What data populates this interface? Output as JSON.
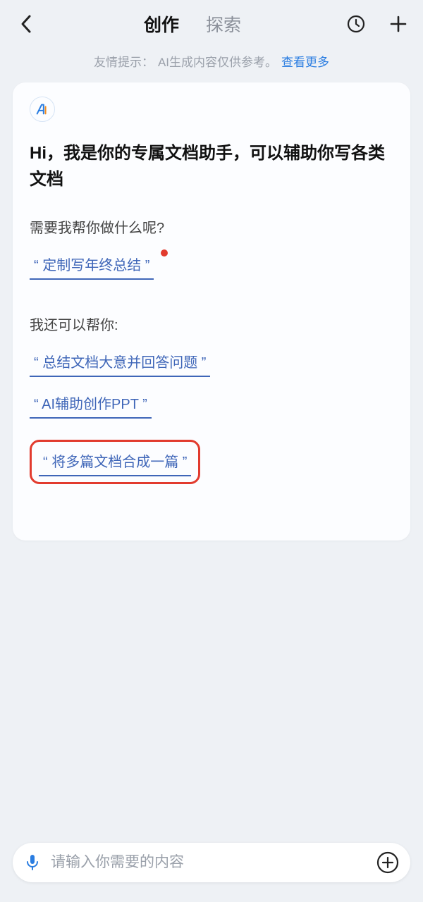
{
  "header": {
    "tabs": [
      "创作",
      "探索"
    ],
    "activeIndex": 0
  },
  "hint": {
    "prefix": "友情提示：",
    "text": "AI生成内容仅供参考。",
    "more": "查看更多"
  },
  "card": {
    "greeting": "Hi，我是你的专属文档助手，可以辅助你写各类文档",
    "question": "需要我帮你做什么呢?",
    "primarySuggestion": "“ 定制写年终总结 ”",
    "moreHeading": "我还可以帮你:",
    "suggestions": [
      "“ 总结文档大意并回答问题 ”",
      "“ AI辅助创作PPT ”",
      "“ 将多篇文档合成一篇 ”"
    ],
    "highlightIndex": 2
  },
  "input": {
    "placeholder": "请输入你需要的内容"
  }
}
